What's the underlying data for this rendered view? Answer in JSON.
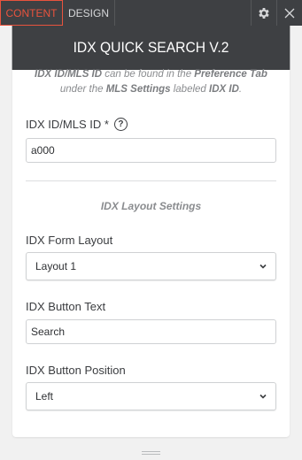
{
  "tabs": {
    "content": "CONTENT",
    "design": "DESIGN"
  },
  "header": {
    "title": "IDX QUICK SEARCH V.2"
  },
  "hint": {
    "p1_bold": "IDX ID/MLS ID",
    "p1_text": " can be found in the ",
    "p1_bold2": "Preference Tab",
    "p2_text": "under the ",
    "p2_bold": "MLS Settings",
    "p2_text2": " labeled ",
    "p2_bold2": "IDX ID",
    "p2_end": "."
  },
  "fields": {
    "idx_id_label": "IDX ID/MLS ID *",
    "idx_id_help": "?",
    "idx_id_value": "a000",
    "section_title": "IDX Layout Settings",
    "form_layout_label": "IDX Form Layout",
    "form_layout_value": "Layout 1",
    "button_text_label": "IDX Button Text",
    "button_text_value": "Search",
    "button_position_label": "IDX Button Position",
    "button_position_value": "Left"
  },
  "colors": {
    "accent": "#e8533e",
    "dark": "#3e4043",
    "background": "#f1f1f1"
  },
  "icons": {
    "settings": "gear-icon",
    "close": "close-icon",
    "select": "chevron-down-icon",
    "resize": "grip-icon"
  }
}
